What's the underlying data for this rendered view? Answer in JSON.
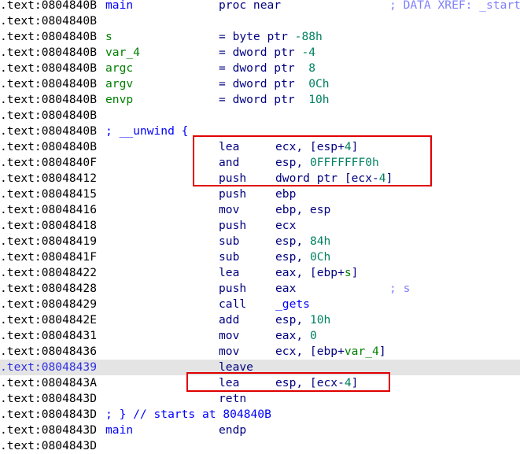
{
  "colors": {
    "label": "#0000ff",
    "var": "#008000",
    "num": "#008060",
    "text": "#000080",
    "comment": "#8080ff",
    "unwind": "#0000ff",
    "highlight_row": "#e4e4e4",
    "annotation_box": "#e00000"
  },
  "highlighted_row": 23,
  "annotation_boxes": [
    {
      "rows": [
        9,
        11
      ]
    },
    {
      "rows": [
        24,
        24
      ]
    }
  ],
  "rows": [
    {
      "addr": ".text:0804840B",
      "name": [
        {
          "t": "main",
          "c": "label"
        }
      ],
      "op": "proc near",
      "comment": "; DATA XREF: _start"
    },
    {
      "addr": ".text:0804840B"
    },
    {
      "addr": ".text:0804840B",
      "name": [
        {
          "t": "s",
          "c": "var"
        }
      ],
      "op": "= byte ptr ",
      "opx": [
        {
          "t": "-88h",
          "c": "num"
        }
      ]
    },
    {
      "addr": ".text:0804840B",
      "name": [
        {
          "t": "var_4",
          "c": "var"
        }
      ],
      "op": "= dword ptr ",
      "opx": [
        {
          "t": "-4",
          "c": "num"
        }
      ]
    },
    {
      "addr": ".text:0804840B",
      "name": [
        {
          "t": "argc",
          "c": "var"
        }
      ],
      "op": "= dword ptr  ",
      "opx": [
        {
          "t": "8",
          "c": "num"
        }
      ]
    },
    {
      "addr": ".text:0804840B",
      "name": [
        {
          "t": "argv",
          "c": "var"
        }
      ],
      "op": "= dword ptr  ",
      "opx": [
        {
          "t": "0Ch",
          "c": "num"
        }
      ]
    },
    {
      "addr": ".text:0804840B",
      "name": [
        {
          "t": "envp",
          "c": "var"
        }
      ],
      "op": "= dword ptr  ",
      "opx": [
        {
          "t": "10h",
          "c": "num"
        }
      ]
    },
    {
      "addr": ".text:0804840B"
    },
    {
      "addr": ".text:0804840B",
      "name": [
        {
          "t": "; __unwind {",
          "c": "unwind"
        }
      ]
    },
    {
      "addr": ".text:0804840B",
      "op": "lea",
      "args": [
        {
          "t": "ecx, [esp+",
          "c": "text"
        },
        {
          "t": "4",
          "c": "num"
        },
        {
          "t": "]",
          "c": "text"
        }
      ]
    },
    {
      "addr": ".text:0804840F",
      "op": "and",
      "args": [
        {
          "t": "esp, ",
          "c": "text"
        },
        {
          "t": "0FFFFFFF0h",
          "c": "num"
        }
      ]
    },
    {
      "addr": ".text:08048412",
      "op": "push",
      "args": [
        {
          "t": "dword ptr [ecx-",
          "c": "text"
        },
        {
          "t": "4",
          "c": "num"
        },
        {
          "t": "]",
          "c": "text"
        }
      ]
    },
    {
      "addr": ".text:08048415",
      "op": "push",
      "args": [
        {
          "t": "ebp",
          "c": "text"
        }
      ]
    },
    {
      "addr": ".text:08048416",
      "op": "mov",
      "args": [
        {
          "t": "ebp, esp",
          "c": "text"
        }
      ]
    },
    {
      "addr": ".text:08048418",
      "op": "push",
      "args": [
        {
          "t": "ecx",
          "c": "text"
        }
      ]
    },
    {
      "addr": ".text:08048419",
      "op": "sub",
      "args": [
        {
          "t": "esp, ",
          "c": "text"
        },
        {
          "t": "84h",
          "c": "num"
        }
      ]
    },
    {
      "addr": ".text:0804841F",
      "op": "sub",
      "args": [
        {
          "t": "esp, ",
          "c": "text"
        },
        {
          "t": "0Ch",
          "c": "num"
        }
      ]
    },
    {
      "addr": ".text:08048422",
      "op": "lea",
      "args": [
        {
          "t": "eax, [ebp+",
          "c": "text"
        },
        {
          "t": "s",
          "c": "var"
        },
        {
          "t": "]",
          "c": "text"
        }
      ]
    },
    {
      "addr": ".text:08048428",
      "op": "push",
      "args": [
        {
          "t": "eax",
          "c": "text"
        }
      ],
      "comment": "; s"
    },
    {
      "addr": ".text:08048429",
      "op": "call",
      "args": [
        {
          "t": "_gets",
          "c": "label"
        }
      ]
    },
    {
      "addr": ".text:0804842E",
      "op": "add",
      "args": [
        {
          "t": "esp, ",
          "c": "text"
        },
        {
          "t": "10h",
          "c": "num"
        }
      ]
    },
    {
      "addr": ".text:08048431",
      "op": "mov",
      "args": [
        {
          "t": "eax, ",
          "c": "text"
        },
        {
          "t": "0",
          "c": "num"
        }
      ]
    },
    {
      "addr": ".text:08048436",
      "op": "mov",
      "args": [
        {
          "t": "ecx, [ebp+",
          "c": "text"
        },
        {
          "t": "var_4",
          "c": "var"
        },
        {
          "t": "]",
          "c": "text"
        }
      ]
    },
    {
      "addr": ".text:08048439",
      "op": "leave"
    },
    {
      "addr": ".text:0804843A",
      "op": "lea",
      "args": [
        {
          "t": "esp, [ecx-",
          "c": "text"
        },
        {
          "t": "4",
          "c": "num"
        },
        {
          "t": "]",
          "c": "text"
        }
      ]
    },
    {
      "addr": ".text:0804843D",
      "op": "retn"
    },
    {
      "addr": ".text:0804843D",
      "name": [
        {
          "t": "; } // starts at 804840B",
          "c": "unwind"
        }
      ]
    },
    {
      "addr": ".text:0804843D",
      "name": [
        {
          "t": "main",
          "c": "label"
        }
      ],
      "op": "endp"
    },
    {
      "addr": ".text:0804843D"
    }
  ]
}
